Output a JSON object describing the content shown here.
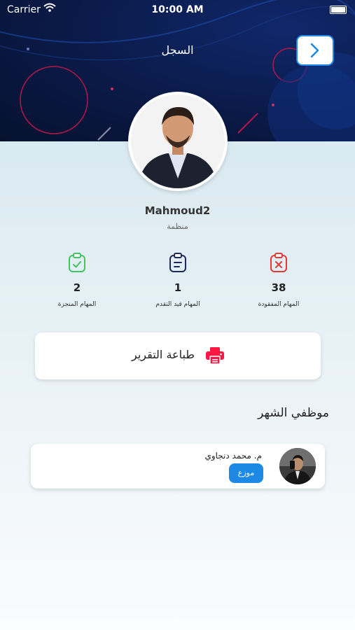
{
  "status_bar": {
    "carrier": "Carrier",
    "time": "10:00 AM"
  },
  "header": {
    "title": "السجل"
  },
  "profile": {
    "name": "Mahmoud2",
    "type": "منظمة"
  },
  "stats": [
    {
      "value": "38",
      "label": "المهام المفقودة",
      "color": "#e53935"
    },
    {
      "value": "1",
      "label": "المهام قيد التقدم",
      "color": "#1e2a5a"
    },
    {
      "value": "2",
      "label": "المهام المنجزة",
      "color": "#43c463"
    }
  ],
  "print": {
    "label": "طباعة التقرير",
    "color": "#ff1744"
  },
  "employees_section": {
    "title": "موظفي الشهر"
  },
  "employees": [
    {
      "name": "م. محمد دنجاوي",
      "role": "موزع"
    }
  ],
  "colors": {
    "accent": "#1e88e5",
    "header_dark": "#0b1c4d"
  }
}
